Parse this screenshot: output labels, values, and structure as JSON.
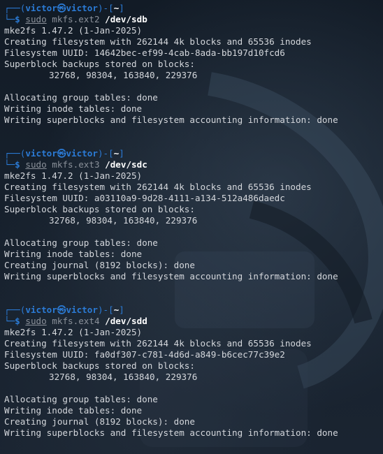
{
  "prompt": {
    "user": "victor",
    "host": "victor",
    "cwd": "~",
    "skull": "㉿"
  },
  "blocks": [
    {
      "sudo": "sudo",
      "command": "mkfs.ext2",
      "device": "/dev/sdb",
      "lines": [
        "mke2fs 1.47.2 (1-Jan-2025)",
        "Creating filesystem with 262144 4k blocks and 65536 inodes",
        "Filesystem UUID: 14642bec-ef99-4cab-8ada-bb197d10fcd6",
        "Superblock backups stored on blocks:"
      ],
      "backups": "32768, 98304, 163840, 229376",
      "tail": [
        "Allocating group tables: done",
        "Writing inode tables: done",
        "Writing superblocks and filesystem accounting information: done"
      ]
    },
    {
      "sudo": "sudo",
      "command": "mkfs.ext3",
      "device": "/dev/sdc",
      "lines": [
        "mke2fs 1.47.2 (1-Jan-2025)",
        "Creating filesystem with 262144 4k blocks and 65536 inodes",
        "Filesystem UUID: a03110a9-9d28-4111-a134-512a486daedc",
        "Superblock backups stored on blocks:"
      ],
      "backups": "32768, 98304, 163840, 229376",
      "tail": [
        "Allocating group tables: done",
        "Writing inode tables: done",
        "Creating journal (8192 blocks): done",
        "Writing superblocks and filesystem accounting information: done"
      ]
    },
    {
      "sudo": "sudo",
      "command": "mkfs.ext4",
      "device": "/dev/sdd",
      "lines": [
        "mke2fs 1.47.2 (1-Jan-2025)",
        "Creating filesystem with 262144 4k blocks and 65536 inodes",
        "Filesystem UUID: fa0df307-c781-4d6d-a849-b6cec77c39e2",
        "Superblock backups stored on blocks:"
      ],
      "backups": "32768, 98304, 163840, 229376",
      "tail": [
        "Allocating group tables: done",
        "Writing inode tables: done",
        "Creating journal (8192 blocks): done",
        "Writing superblocks and filesystem accounting information: done"
      ]
    }
  ],
  "colors": {
    "prompt": "#2b7bd6",
    "text": "#d4d7dc",
    "command": "#8a9099",
    "background": "#111a24"
  }
}
